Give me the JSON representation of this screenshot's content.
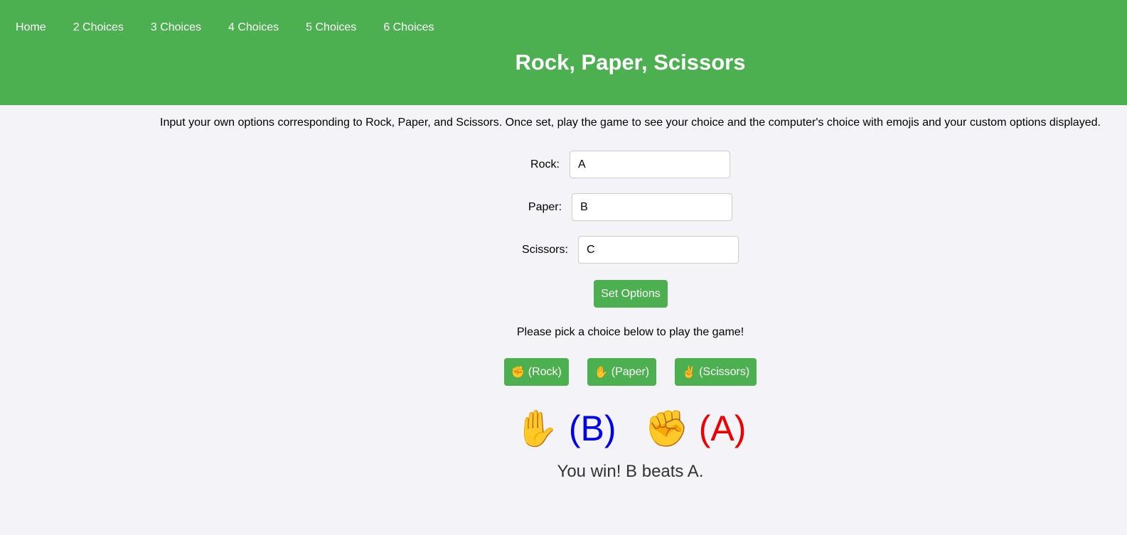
{
  "nav": {
    "items": [
      {
        "label": "Home"
      },
      {
        "label": "2 Choices"
      },
      {
        "label": "3 Choices"
      },
      {
        "label": "4 Choices"
      },
      {
        "label": "5 Choices"
      },
      {
        "label": "6 Choices"
      }
    ]
  },
  "header": {
    "title": "Rock, Paper, Scissors"
  },
  "intro": "Input your own options corresponding to Rock, Paper, and Scissors. Once set, play the game to see your choice and the computer's choice with emojis and your custom options displayed.",
  "form": {
    "rock_label": "Rock:",
    "rock_value": "A",
    "paper_label": "Paper:",
    "paper_value": "B",
    "scissors_label": "Scissors:",
    "scissors_value": "C",
    "set_button": "Set Options"
  },
  "prompt": "Please pick a choice below to play the game!",
  "choices": [
    {
      "emoji": "✊",
      "label": "(Rock)"
    },
    {
      "emoji": "✋",
      "label": "(Paper)"
    },
    {
      "emoji": "✌️",
      "label": "(Scissors)"
    }
  ],
  "result": {
    "user_emoji": "✋",
    "user_option": "(B)",
    "computer_emoji": "✊",
    "computer_option": "(A)",
    "message": "You win! B beats A."
  },
  "colors": {
    "accent": "#4caf50",
    "background": "#f4f4f8",
    "user_option": "#0000ee",
    "computer_option": "#ee0000"
  }
}
